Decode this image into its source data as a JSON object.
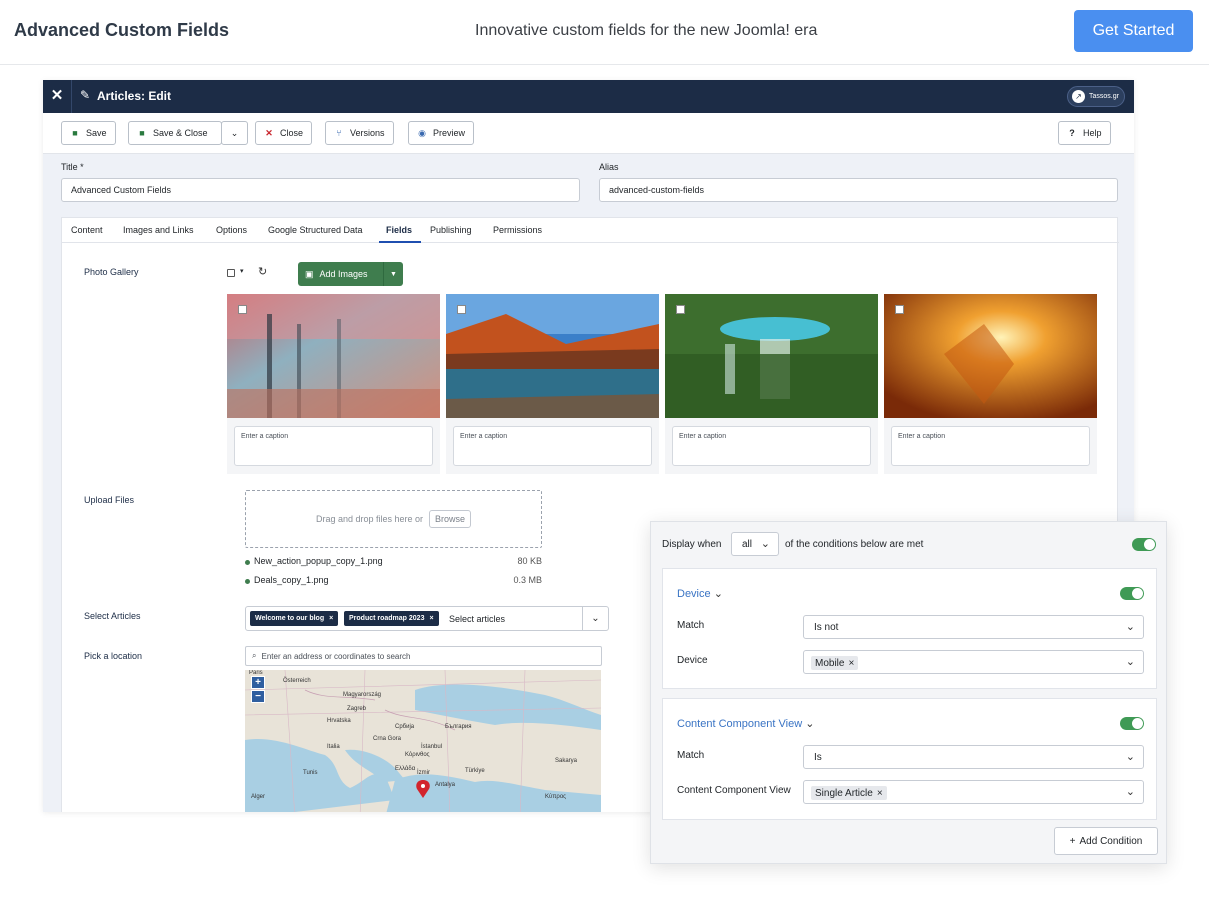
{
  "header": {
    "brand": "Advanced Custom Fields",
    "tagline": "Innovative custom fields for the new Joomla! era",
    "cta_label": "Get Started"
  },
  "admin": {
    "title": "Articles: Edit",
    "site_badge": "Tassos.gr",
    "toolbar": {
      "save": "Save",
      "save_close": "Save & Close",
      "close": "Close",
      "versions": "Versions",
      "preview": "Preview",
      "help": "Help"
    },
    "form": {
      "title_label": "Title *",
      "title_value": "Advanced Custom Fields",
      "alias_label": "Alias",
      "alias_value": "advanced-custom-fields"
    },
    "tabs": [
      "Content",
      "Images and Links",
      "Options",
      "Google Structured Data",
      "Fields",
      "Publishing",
      "Permissions"
    ],
    "active_tab": "Fields",
    "fields": {
      "gallery_label": "Photo Gallery",
      "add_images": "Add Images",
      "caption_placeholder": "Enter a caption",
      "upload_label": "Upload Files",
      "dropzone_text": "Drag and drop files here or",
      "browse": "Browse",
      "files": [
        {
          "name": "New_action_popup_copy_1.png",
          "size": "80 KB"
        },
        {
          "name": "Deals_copy_1.png",
          "size": "0.3 MB"
        }
      ],
      "articles_label": "Select Articles",
      "article_chips": [
        "Welcome to our blog",
        "Product roadmap 2023"
      ],
      "articles_placeholder": "Select articles",
      "location_label": "Pick a location",
      "location_placeholder": "Enter an address or coordinates to search",
      "map_labels": [
        "Paris",
        "Österreich",
        "Magyarország",
        "Zagreb",
        "Hrvatska",
        "Србија",
        "България",
        "Italia",
        "Crna Gora",
        "Κόρινθος",
        "İstanbul",
        "Türkiye",
        "İzmir",
        "Antalya",
        "Ελλάδα",
        "Alger",
        "Tunis",
        "Κύπρος",
        "Sakarya"
      ]
    }
  },
  "conditions": {
    "display_when": "Display when",
    "all_option": "all",
    "suffix": "of the conditions below are met",
    "groups": [
      {
        "title": "Device",
        "match_label": "Match",
        "match_value": "Is not",
        "field_label": "Device",
        "field_tag": "Mobile"
      },
      {
        "title": "Content Component View",
        "match_label": "Match",
        "match_value": "Is",
        "field_label": "Content Component View",
        "field_tag": "Single Article"
      }
    ],
    "add_condition": "Add Condition"
  },
  "colors": {
    "cta": "#4a8ff0",
    "admin_header": "#1c2c46",
    "add_images": "#3f7d4e",
    "toggle_on": "#3f9a55",
    "link": "#3a74c4"
  }
}
